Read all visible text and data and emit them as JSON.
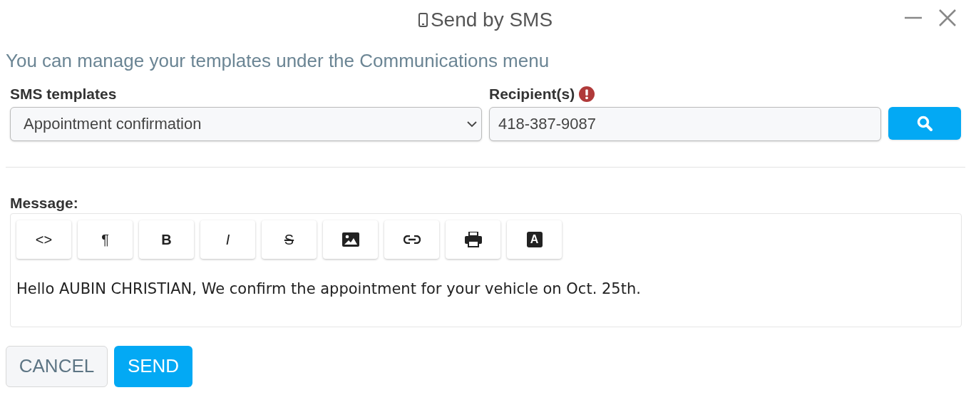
{
  "window": {
    "title": "Send by SMS"
  },
  "notice": "You can manage your templates under the Communications menu",
  "templates": {
    "label": "SMS templates",
    "value": "Appointment confirmation"
  },
  "recipients": {
    "label": "Recipient(s)",
    "error": true,
    "value": "418-387-9087"
  },
  "message": {
    "label": "Message:",
    "toolbar": [
      {
        "kind": "plain",
        "label": "<>"
      },
      {
        "kind": "plain",
        "label": "¶"
      },
      {
        "kind": "bold",
        "label": "B"
      },
      {
        "kind": "italic",
        "label": "I"
      },
      {
        "kind": "strike",
        "label": "S"
      },
      {
        "kind": "image"
      },
      {
        "kind": "link"
      },
      {
        "kind": "print"
      },
      {
        "kind": "letter",
        "label": "A"
      }
    ],
    "body": "Hello AUBIN CHRISTIAN, We confirm the appointment for your vehicle on Oct. 25th."
  },
  "buttons": {
    "cancel": "CANCEL",
    "send": "SEND"
  }
}
